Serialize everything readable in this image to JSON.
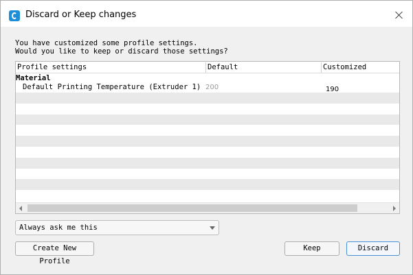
{
  "window": {
    "title": "Discard or Keep changes"
  },
  "message": {
    "line1": "You have customized some profile settings.",
    "line2": "Would you like to keep or discard those settings?"
  },
  "table": {
    "columns": [
      "Profile settings",
      "Default",
      "Customized"
    ],
    "rows": [
      {
        "type": "group",
        "label": "Material"
      },
      {
        "type": "setting",
        "label": "Default Printing Temperature (Extruder 1)",
        "default": "200",
        "customized": "190"
      }
    ]
  },
  "options": {
    "selected": "Always ask me this"
  },
  "buttons": {
    "create_profile": "Create New Profile",
    "keep": "Keep",
    "discard": "Discard"
  },
  "colors": {
    "accent": "#4a90d9",
    "app_icon": "#1e8fd6",
    "row_alt": "#e9e9e9"
  },
  "icons": [
    "app-icon",
    "close-icon",
    "chevron-down-icon",
    "scroll-left-icon",
    "scroll-right-icon"
  ]
}
